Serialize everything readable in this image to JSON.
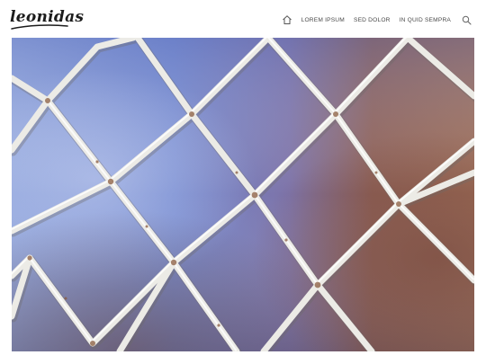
{
  "site": {
    "logo_text": "leonidas"
  },
  "nav": {
    "items": [
      {
        "label": "LOREM IPSUM"
      },
      {
        "label": "SED DOLOR"
      },
      {
        "label": "IN QUID SEMPRA"
      }
    ]
  },
  "icons": {
    "home": "home-icon",
    "search": "search-icon"
  },
  "colors": {
    "header_bg": "#ffffff",
    "nav_text": "#4a4a4a",
    "logo": "#1c1c1c",
    "sky_blue": "#7c93d6",
    "rust_brown": "#8a5a44",
    "wire": "#e9e9e6"
  }
}
